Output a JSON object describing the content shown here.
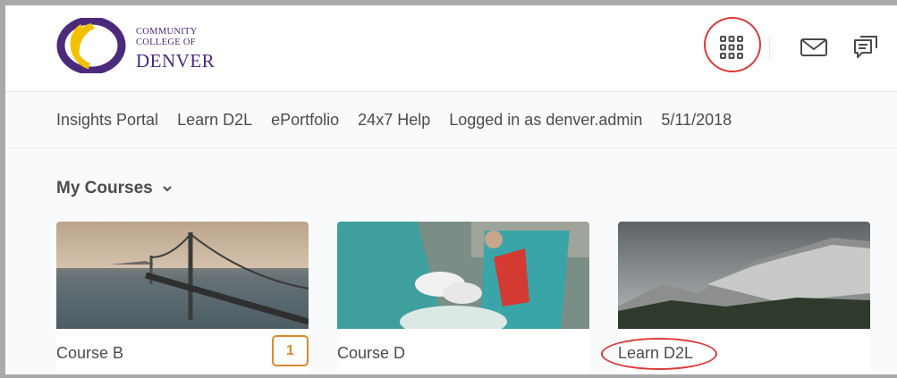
{
  "logo": {
    "line1": "COMMUNITY",
    "line2": "COLLEGE OF",
    "line3": "DENVER",
    "colors": {
      "purple": "#4b2a7c",
      "gold": "#f2c200"
    }
  },
  "header": {
    "icons": [
      "waffle-grid-icon",
      "mail-icon",
      "chat-icon"
    ]
  },
  "nav": {
    "items": [
      {
        "label": "Insights Portal"
      },
      {
        "label": "Learn D2L"
      },
      {
        "label": "ePortfolio"
      },
      {
        "label": "24x7 Help"
      },
      {
        "label": "Logged in as denver.admin"
      },
      {
        "label": "5/11/2018"
      }
    ]
  },
  "my_courses": {
    "title": "My Courses",
    "courses": [
      {
        "title": "Course B",
        "badge": "1",
        "image": "bridge"
      },
      {
        "title": "Course D",
        "badge": "",
        "image": "dental"
      },
      {
        "title": "Learn D2L",
        "badge": "",
        "image": "mountain"
      }
    ]
  },
  "colors": {
    "annotation": "#d93a3a",
    "badge": "#d88a2c",
    "text": "#494c4e"
  }
}
